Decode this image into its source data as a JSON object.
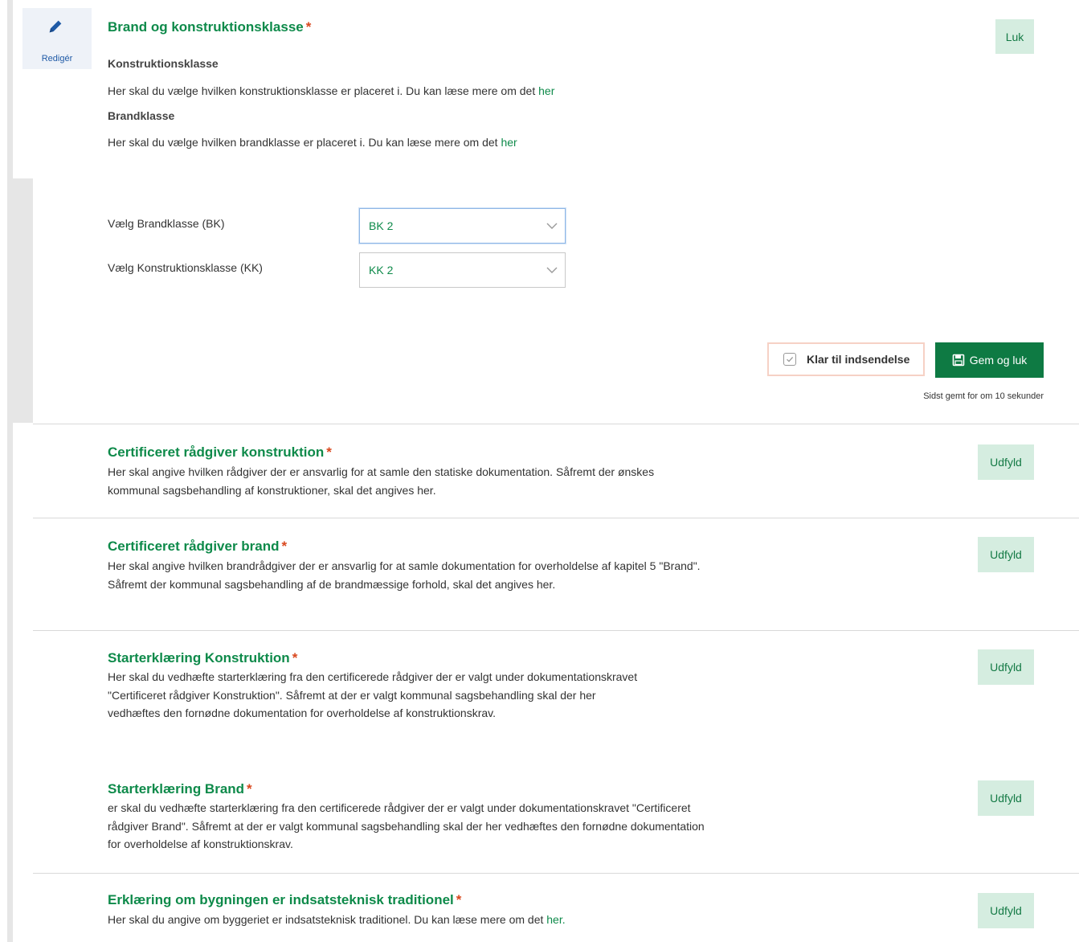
{
  "editor": {
    "edit_label": "Redigér",
    "title": "Brand og konstruktionsklasse",
    "close_label": "Luk",
    "kk_heading": "Konstruktionsklasse",
    "kk_text": "Her skal du vælge hvilken konstruktionsklasse er placeret i. Du kan læse mere om det",
    "kk_link": "her",
    "bk_heading": "Brandklasse",
    "bk_text": "Her skal du vælge hvilken brandklasse er placeret i. Du kan læse mere om det",
    "bk_link": "her",
    "bk_select_label": "Vælg Brandklasse (BK)",
    "bk_value": "BK 2",
    "kk_select_label": "Vælg Konstruktionsklasse (KK)",
    "kk_value": "KK 2",
    "ready_label": "Klar til indsendelse",
    "ready_checked": true,
    "save_label": "Gem og luk",
    "saved_status": "Sidst gemt for om 10 sekunder"
  },
  "required_marker": "*",
  "sections": [
    {
      "title": "Certificeret rådgiver konstruktion",
      "description": "Her skal angive hvilken rådgiver der er ansvarlig for at samle den statiske dokumentation. Såfremt der ønskes kommunal sagsbehandling af konstruktioner, skal det angives her.",
      "button": "Udfyld"
    },
    {
      "title": "Certificeret rådgiver brand",
      "description": "Her skal angive hvilken brandrådgiver der er ansvarlig for at samle dokumentation for overholdelse af kapitel 5 \"Brand\". Såfremt der kommunal sagsbehandling af de brandmæssige forhold, skal det angives her.",
      "button": "Udfyld"
    },
    {
      "title": "Starterklæring Konstruktion",
      "description": "Her skal du vedhæfte starterklæring fra den certificerede rådgiver der er valgt under dokumentationskravet \"Certificeret rådgiver Konstruktion\". Såfremt at der er valgt kommunal sagsbehandling skal der her vedhæftes den fornødne dokumentation for overholdelse af konstruktionskrav.",
      "button": "Udfyld"
    },
    {
      "title": "Starterklæring Brand",
      "description": "er skal du vedhæfte starterklæring fra den certificerede rådgiver der er valgt under dokumentationskravet \"Certificeret rådgiver Brand\". Såfremt at der er valgt kommunal sagsbehandling skal der her vedhæftes den fornødne dokumentation for overholdelse af konstruktionskrav.",
      "button": "Udfyld"
    },
    {
      "title": "Erklæring om bygningen er indsatsteknisk traditionel",
      "description": "Her skal du angive om byggeriet er indsatsteknisk traditionel. Du kan læse mere om det",
      "link": "her.",
      "button": "Udfyld"
    }
  ],
  "colors": {
    "accent_green": "#0e8a4a",
    "button_dark_green": "#0e7a43",
    "button_light_green": "#d5ede0",
    "required_red": "#d9481e"
  },
  "icons": [
    "pencil-icon",
    "chevron-down-icon",
    "checkbox-icon",
    "save-disk-icon"
  ]
}
